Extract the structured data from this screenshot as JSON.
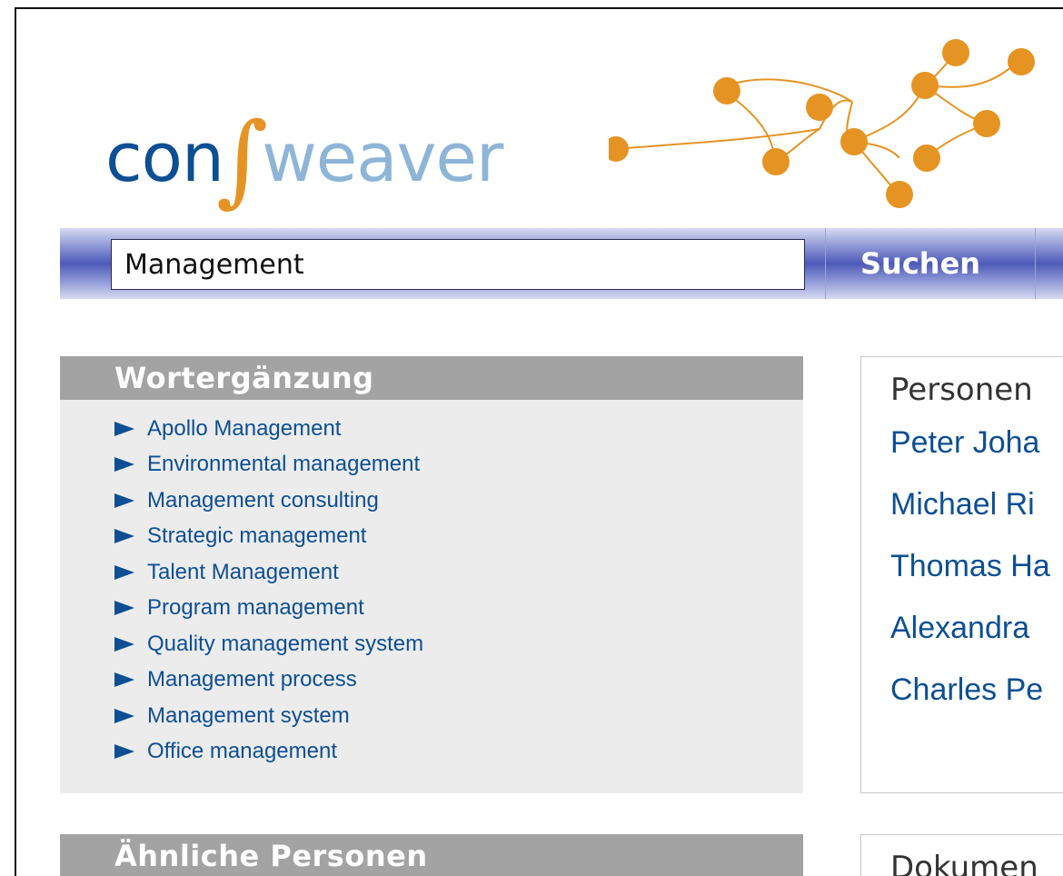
{
  "logo": {
    "part1": "con",
    "part2": "weaver",
    "colors": {
      "dark_blue": "#0d4f93",
      "light_blue": "#8eb5d8",
      "orange": "#e59423"
    }
  },
  "search": {
    "value": "Management",
    "button_label": "Suchen"
  },
  "completion": {
    "title": "Wortergänzung",
    "items": [
      "Apollo Management",
      "Environmental management",
      "Management consulting",
      "Strategic management",
      "Talent Management",
      "Program management",
      "Quality management system",
      "Management process",
      "Management system",
      "Office management"
    ]
  },
  "people": {
    "title": "Personen",
    "items": [
      "Peter Joha",
      "Michael Ri",
      "Thomas Ha",
      "Alexandra",
      "Charles Pe"
    ]
  },
  "similar_people": {
    "title": "Ähnliche Personen"
  },
  "documents": {
    "title": "Dokumen"
  },
  "colors": {
    "link": "#0d4f93",
    "panel_header": "#a3a3a3",
    "panel_bg": "#ececec",
    "search_bar": "#4d5ab8"
  }
}
